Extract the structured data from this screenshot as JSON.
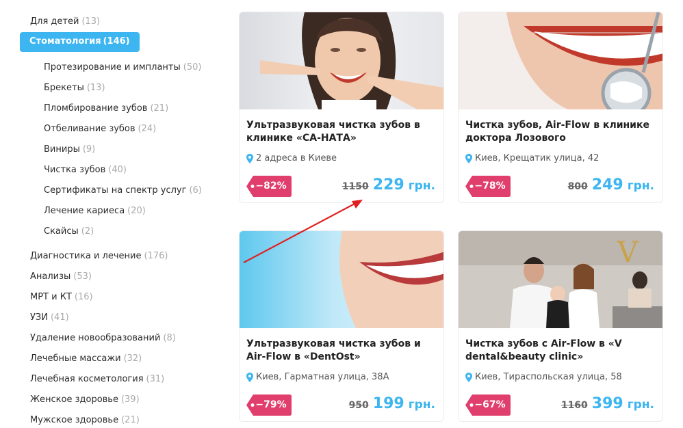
{
  "sidebar": {
    "categories": [
      {
        "label": "Для детей",
        "count": "(13)"
      },
      {
        "label": "Стоматология",
        "count": "(146)"
      },
      {
        "label": "Протезирование и импланты",
        "count": "(50)"
      },
      {
        "label": "Брекеты",
        "count": "(13)"
      },
      {
        "label": "Пломбирование зубов",
        "count": "(21)"
      },
      {
        "label": "Отбеливание зубов",
        "count": "(24)"
      },
      {
        "label": "Виниры",
        "count": "(9)"
      },
      {
        "label": "Чистка зубов",
        "count": "(40)"
      },
      {
        "label": "Сертификаты на спектр услуг",
        "count": "(6)"
      },
      {
        "label": "Лечение кариеса",
        "count": "(20)"
      },
      {
        "label": "Скайсы",
        "count": "(2)"
      },
      {
        "label": "Диагностика и лечение",
        "count": "(176)"
      },
      {
        "label": "Анализы",
        "count": "(53)"
      },
      {
        "label": "МРТ и КТ",
        "count": "(16)"
      },
      {
        "label": "УЗИ",
        "count": "(41)"
      },
      {
        "label": "Удаление новообразований",
        "count": "(8)"
      },
      {
        "label": "Лечебные массажи",
        "count": "(32)"
      },
      {
        "label": "Лечебная косметология",
        "count": "(31)"
      },
      {
        "label": "Женское здоровье",
        "count": "(39)"
      },
      {
        "label": "Мужское здоровье",
        "count": "(21)"
      }
    ]
  },
  "cards": [
    {
      "title": "Ультразвуковая чистка зубов в клинике «СА-НАТА»",
      "address": "2 адреса в Киеве",
      "discount": "−82%",
      "old_price": "1150",
      "new_price": "229",
      "currency": "грн."
    },
    {
      "title": "Чистка зубов, Air-Flow в клинике доктора Лозового",
      "address": "Киев, Крещатик улица, 42",
      "discount": "−78%",
      "old_price": "800",
      "new_price": "249",
      "currency": "грн."
    },
    {
      "title": "Ультразвуковая чистка зубов и Air-Flow в «DentOst»",
      "address": "Киев, Гарматная улица, 38А",
      "discount": "−79%",
      "old_price": "950",
      "new_price": "199",
      "currency": "грн."
    },
    {
      "title": "Чистка зубов с Air-Flow в «V dental&beauty clinic»",
      "address": "Киев, Тираспольская улица, 58",
      "discount": "−67%",
      "old_price": "1160",
      "new_price": "399",
      "currency": "грн."
    }
  ],
  "colors": {
    "accent": "#3cb5f0",
    "badge": "#e03e6c",
    "arrow": "#e02020"
  }
}
